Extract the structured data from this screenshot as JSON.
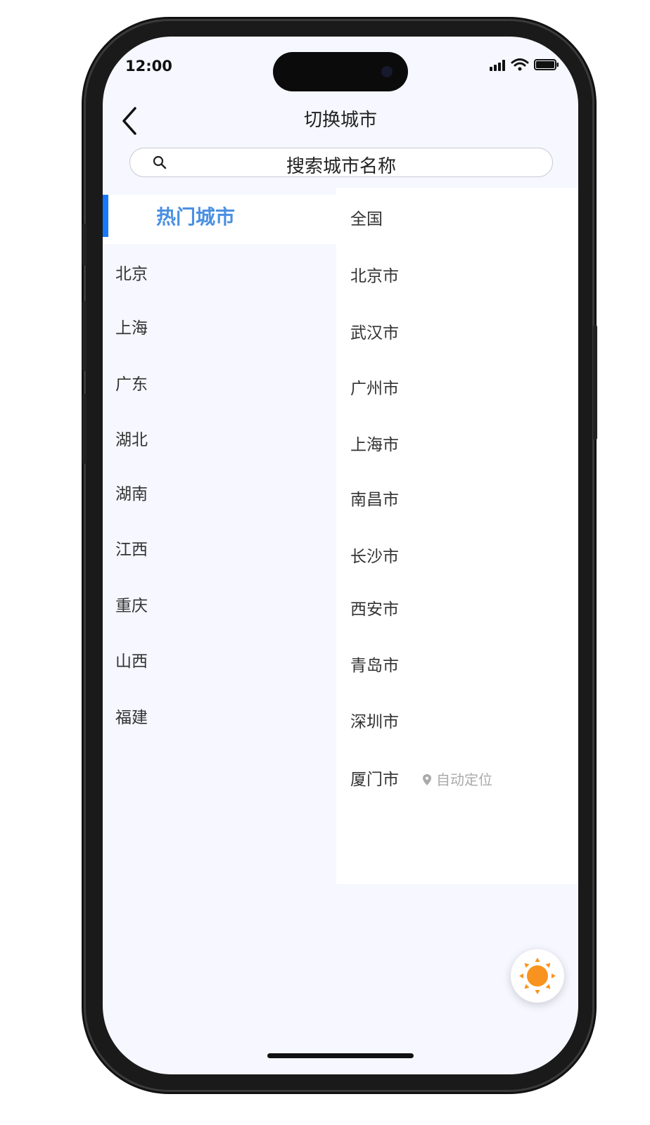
{
  "status_bar": {
    "time": "12:00"
  },
  "header": {
    "title": "切换城市"
  },
  "search": {
    "placeholder": "搜索城市名称"
  },
  "provinces": {
    "active": "热门城市",
    "items": [
      "北京",
      "上海",
      "广东",
      "湖北",
      "湖南",
      "江西",
      "重庆",
      "山西",
      "福建"
    ]
  },
  "cities": {
    "items": [
      "全国",
      "北京市",
      "武汉市",
      "广州市",
      "上海市",
      "南昌市",
      "长沙市",
      "西安市",
      "青岛市",
      "深圳市",
      "厦门市"
    ],
    "auto_locate_label": "自动定位"
  },
  "colors": {
    "accent": "#1677ff",
    "active_text": "#4a90e2",
    "sun": "#f7931e",
    "background": "#f6f7ff"
  }
}
